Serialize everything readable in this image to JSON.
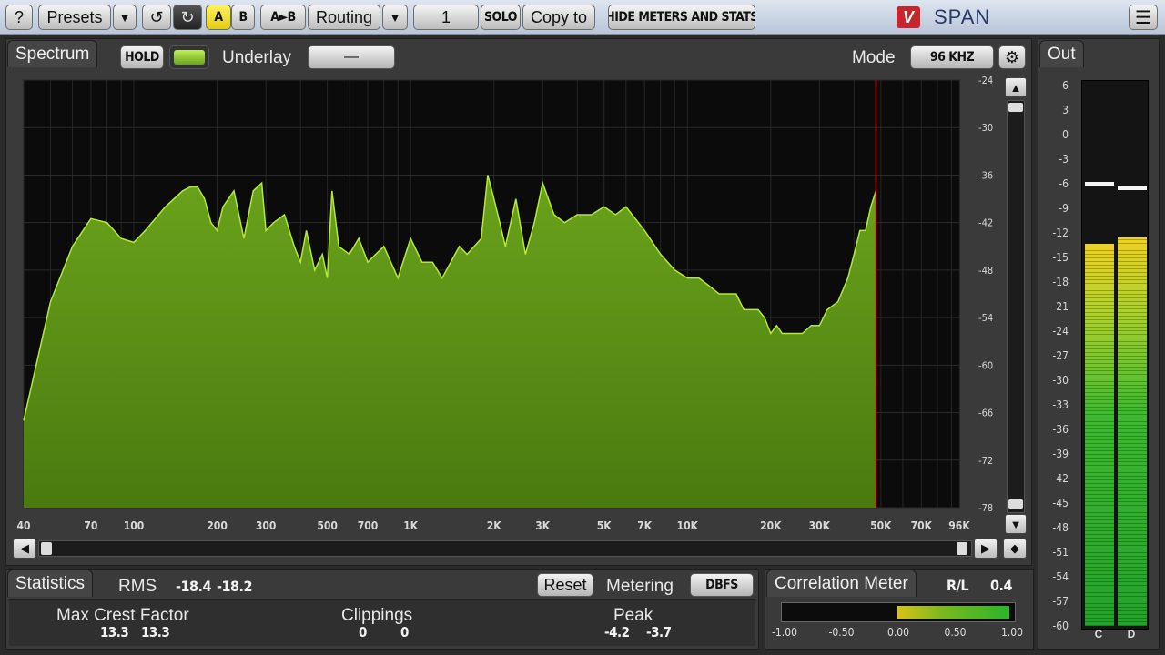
{
  "toolbar": {
    "help": "?",
    "presets": "Presets",
    "presets_arrow": "▼",
    "undo": "↺",
    "redo": "↻",
    "a": "A",
    "b": "B",
    "a_to_b": "A►B",
    "routing": "Routing",
    "routing_arrow": "▼",
    "channel": "1",
    "solo": "SOLO",
    "copy_to": "Copy to",
    "hide_meters": "HIDE METERS AND STATS",
    "logo_mark": "V",
    "app_name": "SPAN",
    "menu": "☰"
  },
  "spectrum": {
    "tab": "Spectrum",
    "hold": "HOLD",
    "underlay_label": "Underlay",
    "underlay_value": "—",
    "mode_label": "Mode",
    "mode_value": "96 KHZ",
    "y_ticks": [
      "-24",
      "-30",
      "-36",
      "-42",
      "-48",
      "-54",
      "-60",
      "-66",
      "-72",
      "-78"
    ],
    "x_ticks": [
      {
        "label": "40",
        "hz": 40
      },
      {
        "label": "70",
        "hz": 70
      },
      {
        "label": "100",
        "hz": 100
      },
      {
        "label": "200",
        "hz": 200
      },
      {
        "label": "300",
        "hz": 300
      },
      {
        "label": "500",
        "hz": 500
      },
      {
        "label": "700",
        "hz": 700
      },
      {
        "label": "1K",
        "hz": 1000
      },
      {
        "label": "2K",
        "hz": 2000
      },
      {
        "label": "3K",
        "hz": 3000
      },
      {
        "label": "5K",
        "hz": 5000
      },
      {
        "label": "7K",
        "hz": 7000
      },
      {
        "label": "10K",
        "hz": 10000
      },
      {
        "label": "20K",
        "hz": 20000
      },
      {
        "label": "30K",
        "hz": 30000
      },
      {
        "label": "50K",
        "hz": 50000
      },
      {
        "label": "70K",
        "hz": 70000
      },
      {
        "label": "96K",
        "hz": 96000
      }
    ],
    "colors": {
      "fill": "#4a7a10",
      "stroke": "#b6e83a",
      "marker": "#e02020"
    }
  },
  "chart_data": {
    "type": "area",
    "x_scale": "log",
    "xlim": [
      40,
      96000
    ],
    "ylim": [
      -78,
      -24
    ],
    "grid": true,
    "marker_hz": 48000,
    "x": [
      40,
      50,
      60,
      70,
      80,
      90,
      100,
      110,
      130,
      150,
      160,
      170,
      180,
      190,
      200,
      210,
      230,
      250,
      270,
      290,
      300,
      320,
      350,
      380,
      400,
      420,
      450,
      480,
      500,
      520,
      550,
      600,
      650,
      700,
      800,
      900,
      1000,
      1100,
      1200,
      1300,
      1500,
      1600,
      1800,
      1900,
      2000,
      2100,
      2200,
      2400,
      2600,
      2800,
      3000,
      3300,
      3600,
      4000,
      4500,
      5000,
      5500,
      6000,
      7000,
      8000,
      9000,
      10000,
      11000,
      12000,
      13000,
      14000,
      15000,
      16000,
      17000,
      18000,
      19000,
      20000,
      21000,
      22000,
      24000,
      26000,
      28000,
      30000,
      32000,
      35000,
      38000,
      40000,
      42000,
      44000,
      46000,
      48000
    ],
    "y": [
      -67,
      -52,
      -45,
      -41.5,
      -42,
      -44,
      -44.5,
      -43,
      -40,
      -38,
      -37.5,
      -37.5,
      -39,
      -42,
      -43,
      -40,
      -38,
      -44,
      -38,
      -37,
      -43,
      -42,
      -41,
      -45,
      -47,
      -43,
      -48,
      -46,
      -49,
      -38,
      -45,
      -46,
      -44,
      -47,
      -45,
      -49,
      -44,
      -47,
      -47,
      -49,
      -45,
      -46,
      -44,
      -36,
      -39,
      -42,
      -45,
      -39,
      -46,
      -42,
      -37,
      -41,
      -42,
      -41,
      -41,
      -40,
      -41,
      -40,
      -43,
      -46,
      -48,
      -49,
      -49,
      -50,
      -51,
      -51,
      -51,
      -53,
      -53,
      -53,
      -54,
      -56,
      -55,
      -56,
      -56,
      -56,
      -55,
      -55,
      -53,
      -52,
      -49,
      -46,
      -43,
      -43,
      -40,
      -38,
      -38
    ]
  },
  "out_meter": {
    "tab": "Out",
    "ticks": [
      "6",
      "3",
      "0",
      "-3",
      "-6",
      "-9",
      "-12",
      "-15",
      "-18",
      "-21",
      "-24",
      "-27",
      "-30",
      "-33",
      "-36",
      "-39",
      "-42",
      "-45",
      "-48",
      "-51",
      "-54",
      "-57",
      "-60"
    ],
    "channels": [
      {
        "name": "C",
        "level_db": -13.3,
        "peak_db": -6.0
      },
      {
        "name": "D",
        "level_db": -12.6,
        "peak_db": -6.6
      }
    ]
  },
  "statistics": {
    "tab": "Statistics",
    "rms_label": "RMS",
    "rms_left": "-18.4",
    "rms_right": "-18.2",
    "reset": "Reset",
    "metering_label": "Metering",
    "metering_value": "DBFS",
    "crest_label": "Max Crest Factor",
    "crest_left": "13.3",
    "crest_right": "13.3",
    "clip_label": "Clippings",
    "clip_left": "0",
    "clip_right": "0",
    "peak_label": "Peak",
    "peak_left": "-4.2",
    "peak_right": "-3.7"
  },
  "correlation": {
    "tab": "Correlation Meter",
    "mode": "R/L",
    "value": "0.4",
    "ticks": [
      "-1.00",
      "-0.50",
      "0.00",
      "0.50",
      "1.00"
    ],
    "range_low": 0.0,
    "range_high": 1.0
  }
}
